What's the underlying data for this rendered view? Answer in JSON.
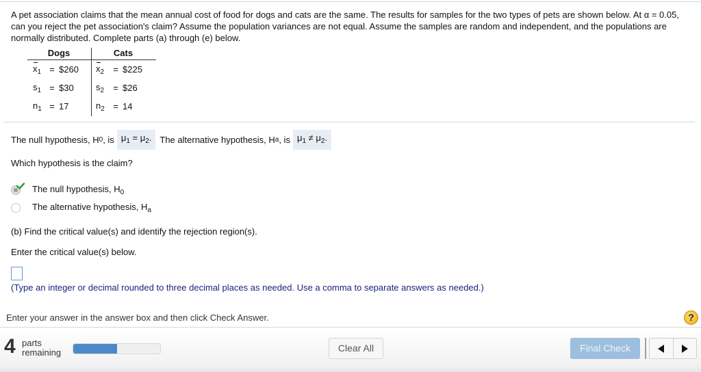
{
  "question": {
    "text": "A pet association claims that the mean annual cost of food for dogs and cats are the same. The results for samples for the two types of pets are shown below. At α = 0.05, can you reject the pet association's claim? Assume the population variances are not equal. Assume the samples are random and independent, and the populations are normally distributed. Complete parts (a) through (e) below."
  },
  "table": {
    "headers": [
      "Dogs",
      "Cats"
    ],
    "rows": [
      {
        "sym1": "x",
        "sub1": "1",
        "val1": "$260",
        "sym2": "x",
        "sub2": "2",
        "val2": "$225"
      },
      {
        "sym1": "s",
        "sub1": "1",
        "val1": "$30",
        "sym2": "s",
        "sub2": "2",
        "val2": "$26"
      },
      {
        "sym1": "n",
        "sub1": "1",
        "val1": "17",
        "sym2": "n",
        "sub2": "2",
        "val2": "14"
      }
    ],
    "eq": "="
  },
  "hypotheses": {
    "null_prefix": "The null hypothesis, H",
    "null_sub": "0",
    "null_is": ", is",
    "null_answer": "μ",
    "null_answer_sub1": "1",
    "null_op": " = ",
    "null_answer2": "μ",
    "null_answer_sub2": "2",
    "null_period": ".",
    "alt_prefix": "The alternative hypothesis, H",
    "alt_sub": "a",
    "alt_is": ", is",
    "alt_answer": "μ",
    "alt_answer_sub1": "1",
    "alt_op": " ≠ ",
    "alt_answer2": "μ",
    "alt_answer_sub2": "2",
    "alt_period": "."
  },
  "claim": {
    "question": "Which hypothesis is the claim?",
    "options": [
      {
        "label": "The null hypothesis, H",
        "sub": "0",
        "selected": true,
        "correct": true
      },
      {
        "label": "The alternative hypothesis, H",
        "sub": "a",
        "selected": false
      }
    ]
  },
  "part_b": {
    "title": "(b) Find the critical value(s) and identify the rejection region(s).",
    "prompt": "Enter the critical value(s) below.",
    "answer_value": "",
    "hint": "(Type an integer or decimal rounded to three decimal places as needed. Use a comma to separate answers as needed.)"
  },
  "instructions": "Enter your answer in the answer box and then click Check Answer.",
  "help_label": "?",
  "footer": {
    "parts_count": "4",
    "parts_line1": "parts",
    "parts_line2": "remaining",
    "progress_fraction": 0.5,
    "clear_all_label": "Clear All",
    "final_check_label": "Final Check",
    "colors": {
      "progress": "#4a8ac9",
      "final_check_bg": "#9dbfde",
      "check_mark": "#2e9e3a"
    }
  }
}
